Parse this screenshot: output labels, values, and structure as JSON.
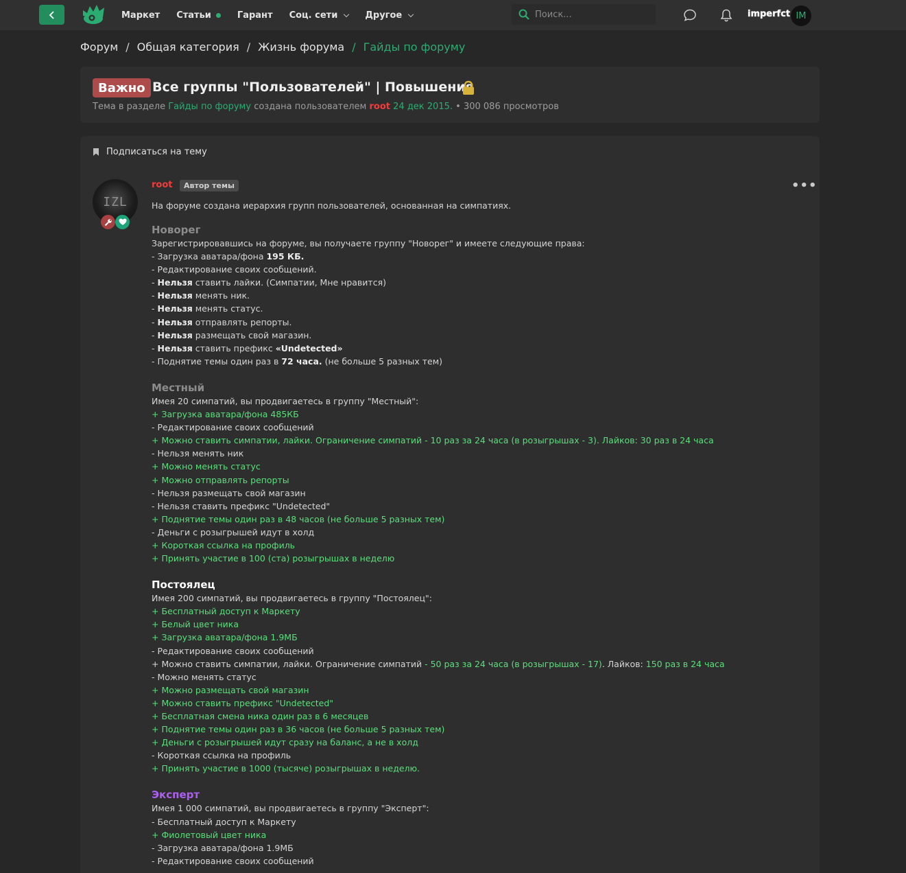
{
  "header": {
    "nav": [
      {
        "label": "Маркет",
        "dot": false,
        "caret": false
      },
      {
        "label": "Статьи",
        "dot": true,
        "caret": false
      },
      {
        "label": "Гарант",
        "dot": false,
        "caret": false
      },
      {
        "label": "Соц. сети",
        "dot": false,
        "caret": true
      },
      {
        "label": "Другое",
        "dot": false,
        "caret": true
      }
    ],
    "search_placeholder": "Поиск...",
    "username": "imperfct",
    "avatar_initials": "IM"
  },
  "breadcrumb": [
    "Форум",
    "Общая категория",
    "Жизнь форума",
    "Гайды по форуму"
  ],
  "thread": {
    "badge": "Важно",
    "title": "Все группы \"Пользователей\" | Повышения",
    "meta_prefix": "Тема в разделе",
    "meta_section": "Гайды по форуму",
    "meta_created": "создана пользователем",
    "meta_author": "root",
    "meta_date": "24 дек 2015.",
    "meta_views": "• 300 086 просмотров"
  },
  "post": {
    "subscribe_label": "Подписаться на тему",
    "author": "root",
    "author_badge": "Автор темы",
    "avatar_text": "IZL",
    "more_label": "•••",
    "intro": "На форуме создана иерархия групп пользователей, основанная на симпатиях.",
    "sections": [
      {
        "title": "Новорег",
        "color": "gray",
        "lines": [
          {
            "type": "plain",
            "parts": [
              {
                "t": "Зарегистрировавшись на форуме, вы получаете группу \"Новорег\" и имеете следующие права:"
              }
            ]
          },
          {
            "type": "plain",
            "parts": [
              {
                "t": "- Загрузка аватара/фона "
              },
              {
                "t": "195 КБ.",
                "b": true
              }
            ]
          },
          {
            "type": "plain",
            "parts": [
              {
                "t": "- Редактирование своих сообщений."
              }
            ]
          },
          {
            "type": "plain",
            "parts": [
              {
                "t": "- "
              },
              {
                "t": "Нельзя",
                "b": true
              },
              {
                "t": " ставить лайки. (Симпатии, Мне нравится)"
              }
            ]
          },
          {
            "type": "plain",
            "parts": [
              {
                "t": "- "
              },
              {
                "t": "Нельзя",
                "b": true
              },
              {
                "t": " менять ник."
              }
            ]
          },
          {
            "type": "plain",
            "parts": [
              {
                "t": "- "
              },
              {
                "t": "Нельзя",
                "b": true
              },
              {
                "t": " менять статус."
              }
            ]
          },
          {
            "type": "plain",
            "parts": [
              {
                "t": "- "
              },
              {
                "t": "Нельзя",
                "b": true
              },
              {
                "t": " отправлять репорты."
              }
            ]
          },
          {
            "type": "plain",
            "parts": [
              {
                "t": "- "
              },
              {
                "t": "Нельзя",
                "b": true
              },
              {
                "t": " размещать свой магазин."
              }
            ]
          },
          {
            "type": "plain",
            "parts": [
              {
                "t": "- "
              },
              {
                "t": "Нельзя",
                "b": true
              },
              {
                "t": " ставить префикс "
              },
              {
                "t": "«Undetected»",
                "b": true
              }
            ]
          },
          {
            "type": "plain",
            "parts": [
              {
                "t": "- Поднятие темы один раз в "
              },
              {
                "t": "72 часа.",
                "b": true
              },
              {
                "t": " (не больше 5 разных тем)"
              }
            ]
          }
        ]
      },
      {
        "title": "Местный",
        "color": "gray",
        "lines": [
          {
            "type": "plain",
            "parts": [
              {
                "t": "Имея 20 симпатий, вы продвигаетесь в группу \"Местный\":"
              }
            ]
          },
          {
            "type": "green",
            "parts": [
              {
                "t": "+ Загрузка аватара/фона 485КБ"
              }
            ]
          },
          {
            "type": "plain",
            "parts": [
              {
                "t": "- Редактирование своих сообщений"
              }
            ]
          },
          {
            "type": "green",
            "parts": [
              {
                "t": "+ Можно ставить симпатии, лайки. Ограничение симпатий - 10 раз за 24 часа (в розыгрышах - 3). Лайков: 30 раз в 24 часа"
              }
            ]
          },
          {
            "type": "plain",
            "parts": [
              {
                "t": "- Нельзя менять ник"
              }
            ]
          },
          {
            "type": "green",
            "parts": [
              {
                "t": "+ Можно менять статус"
              }
            ]
          },
          {
            "type": "green",
            "parts": [
              {
                "t": "+ Можно отправлять репорты"
              }
            ]
          },
          {
            "type": "plain",
            "parts": [
              {
                "t": "- Нельзя размещать свой магазин"
              }
            ]
          },
          {
            "type": "plain",
            "parts": [
              {
                "t": "- Нельзя ставить префикс \"Undetected\""
              }
            ]
          },
          {
            "type": "green",
            "parts": [
              {
                "t": "+ Поднятие темы один раз в 48 часов (не больше 5 разных тем)"
              }
            ]
          },
          {
            "type": "plain",
            "parts": [
              {
                "t": "- Деньги с розыгрышей идут в холд"
              }
            ]
          },
          {
            "type": "green",
            "parts": [
              {
                "t": "+ Короткая ссылка на профиль"
              }
            ]
          },
          {
            "type": "green",
            "parts": [
              {
                "t": "+ Принять участие в 100 (ста) розыгрышах в неделю"
              }
            ]
          }
        ]
      },
      {
        "title": "Постоялец",
        "color": "white",
        "lines": [
          {
            "type": "plain",
            "parts": [
              {
                "t": "Имея 200 симпатий, вы продвигаетесь в группу \"Постоялец\":"
              }
            ]
          },
          {
            "type": "green",
            "parts": [
              {
                "t": "+ Бесплатный доступ к Маркету"
              }
            ]
          },
          {
            "type": "green",
            "parts": [
              {
                "t": "+ Белый цвет ника"
              }
            ]
          },
          {
            "type": "green",
            "parts": [
              {
                "t": "+ Загрузка аватара/фона 1.9МБ"
              }
            ]
          },
          {
            "type": "plain",
            "parts": [
              {
                "t": "- Редактирование своих сообщений"
              }
            ]
          },
          {
            "type": "plain",
            "parts": [
              {
                "t": "+ Можно ставить симпатии, лайки. Ограничение симпатий "
              },
              {
                "t": "- 50 раз за 24 часа (в розыгрышах - 17)",
                "g": true
              },
              {
                "t": ". Лайков: "
              },
              {
                "t": "150 раз в 24 часа",
                "g": true
              }
            ]
          },
          {
            "type": "plain",
            "parts": [
              {
                "t": "- Можно менять статус"
              }
            ]
          },
          {
            "type": "green",
            "parts": [
              {
                "t": "+ Можно размещать свой магазин"
              }
            ]
          },
          {
            "type": "green",
            "parts": [
              {
                "t": "+ Можно ставить префикс \"Undetected\""
              }
            ]
          },
          {
            "type": "green",
            "parts": [
              {
                "t": "+ Бесплатная смена ника один раз в 6 месяцев"
              }
            ]
          },
          {
            "type": "green",
            "parts": [
              {
                "t": "+ Поднятие темы один раз в 36 часов (не больше 5 разных тем)"
              }
            ]
          },
          {
            "type": "green",
            "parts": [
              {
                "t": "+ Деньги с розыгрышей идут сразу на баланс, а не в холд"
              }
            ]
          },
          {
            "type": "plain",
            "parts": [
              {
                "t": "- Короткая ссылка на профиль"
              }
            ]
          },
          {
            "type": "green",
            "parts": [
              {
                "t": "+ Принять участие в 1000 (тысяче) розыгрышах в неделю."
              }
            ]
          }
        ]
      },
      {
        "title": "Эксперт",
        "color": "purple",
        "lines": [
          {
            "type": "plain",
            "parts": [
              {
                "t": "Имея 1 000 симпатий, вы продвигаетесь в группу \"Эксперт\":"
              }
            ]
          },
          {
            "type": "plain",
            "parts": [
              {
                "t": "- Бесплатный доступ к Маркету"
              }
            ]
          },
          {
            "type": "green",
            "parts": [
              {
                "t": "+ Фиолетовый цвет ника"
              }
            ]
          },
          {
            "type": "plain",
            "parts": [
              {
                "t": "- Загрузка аватара/фона 1.9МБ"
              }
            ]
          },
          {
            "type": "plain",
            "parts": [
              {
                "t": "- Редактирование своих сообщений"
              }
            ]
          }
        ]
      }
    ]
  },
  "icons": [
    "back-arrow-icon",
    "logo-icon",
    "search-icon",
    "chat-bubble-icon",
    "bell-icon",
    "lock-icon",
    "bookmark-icon",
    "wrench-icon",
    "heart-icon"
  ],
  "colors": {
    "accent": "#2bad72",
    "important_badge": "#ad4b4b",
    "author_red": "#f23c3c",
    "green_text": "#58e07a",
    "purple": "#ad5ff2"
  }
}
